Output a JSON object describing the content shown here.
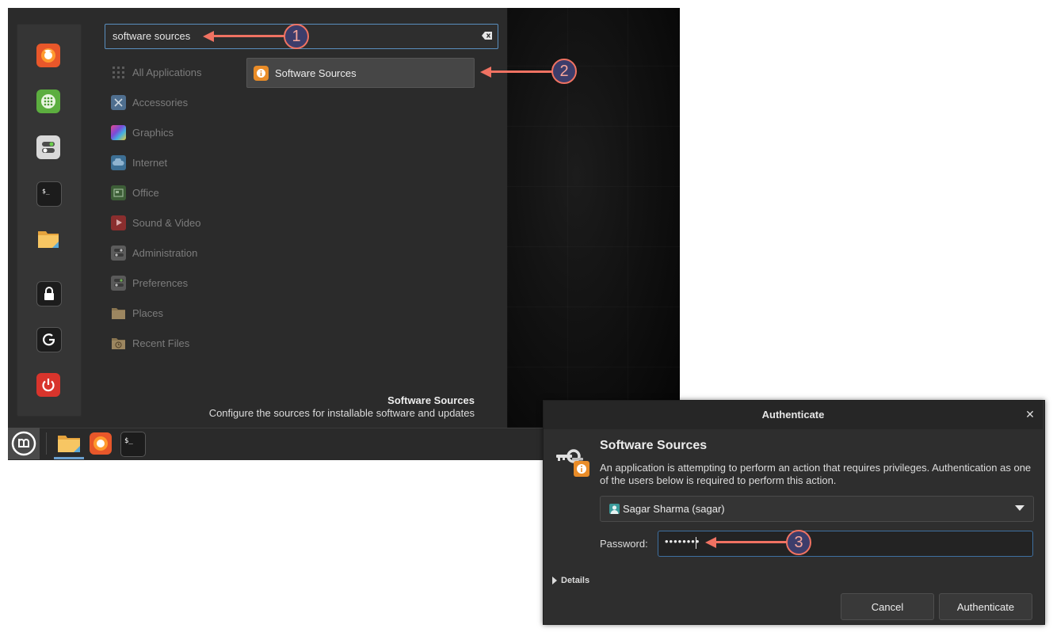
{
  "menu": {
    "search": {
      "value": "software sources"
    },
    "categories": [
      {
        "label": "All Applications",
        "icon": "grid-icon"
      },
      {
        "label": "Accessories",
        "icon": "accessories-icon"
      },
      {
        "label": "Graphics",
        "icon": "graphics-icon"
      },
      {
        "label": "Internet",
        "icon": "internet-cloud-icon"
      },
      {
        "label": "Office",
        "icon": "office-icon"
      },
      {
        "label": "Sound & Video",
        "icon": "play-icon"
      },
      {
        "label": "Administration",
        "icon": "administration-icon"
      },
      {
        "label": "Preferences",
        "icon": "preferences-icon"
      },
      {
        "label": "Places",
        "icon": "folder-icon"
      },
      {
        "label": "Recent Files",
        "icon": "recent-files-icon"
      }
    ],
    "result": {
      "label": "Software Sources",
      "icon": "software-sources-icon"
    },
    "description": {
      "title": "Software Sources",
      "text": "Configure the sources for installable software and updates"
    },
    "favorites": [
      "firefox-icon",
      "software-manager-icon",
      "system-settings-icon",
      "terminal-icon",
      "files-icon",
      "lock-icon",
      "logout-icon",
      "power-icon"
    ]
  },
  "taskbar": {
    "items": [
      "menu-icon",
      "files-icon",
      "firefox-icon",
      "terminal-icon"
    ]
  },
  "callouts": [
    "1",
    "2",
    "3"
  ],
  "dialog": {
    "title": "Authenticate",
    "app_name": "Software Sources",
    "message": "An application is attempting to perform an action that requires privileges. Authentication as one of the users below is required to perform this action.",
    "user": "Sagar Sharma (sagar)",
    "password_label": "Password:",
    "password_value": "••••••••",
    "details_label": "Details",
    "cancel_label": "Cancel",
    "authenticate_label": "Authenticate"
  },
  "colors": {
    "callout_accent": "#f07262",
    "menu_bg": "#2b2b2b",
    "focus_border": "#5a8fbf",
    "result_icon": "#e98c28"
  }
}
